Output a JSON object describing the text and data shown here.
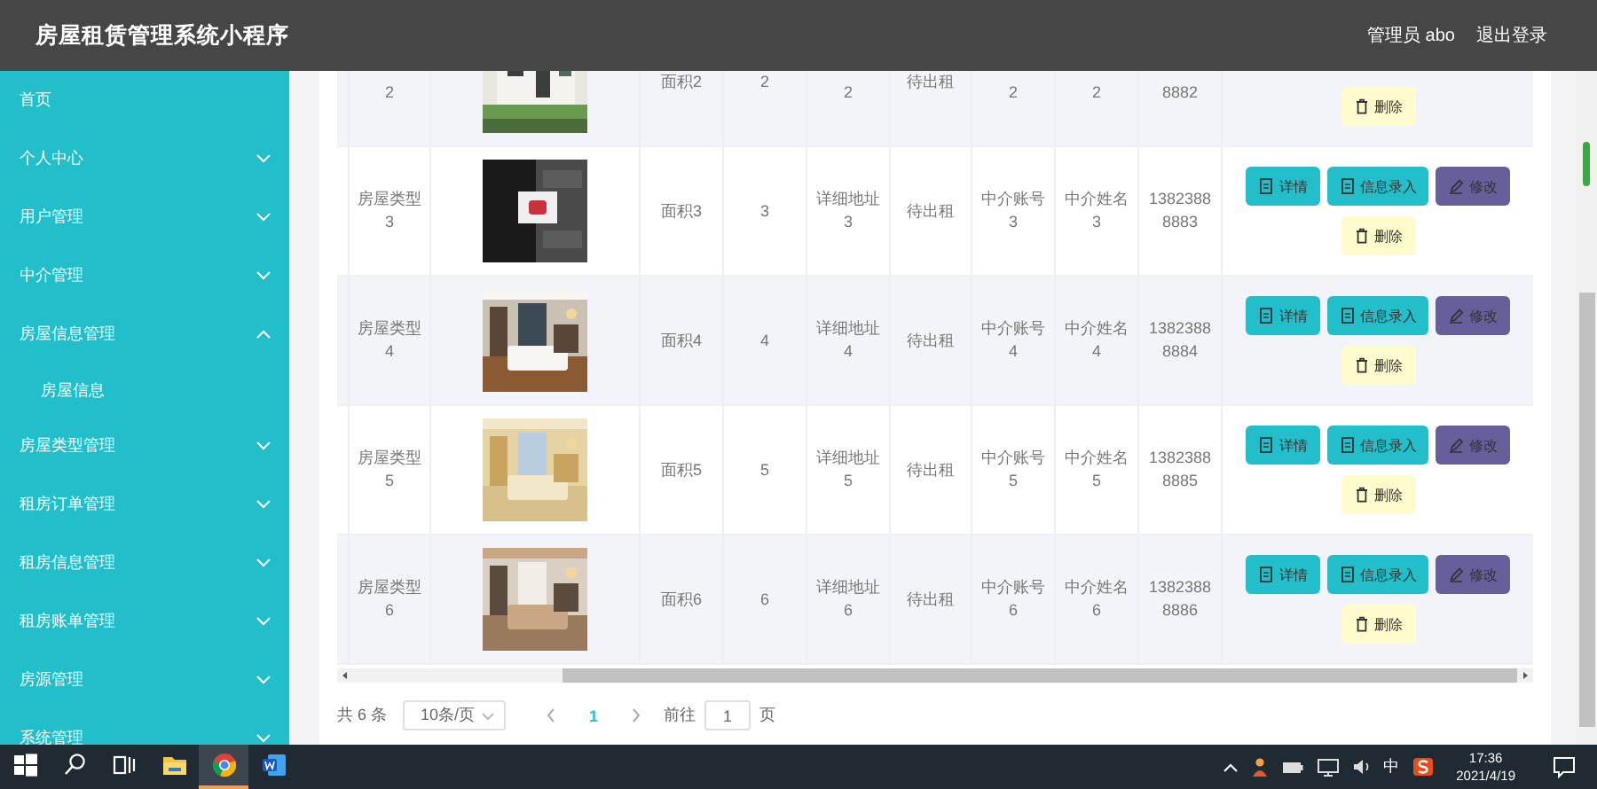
{
  "header": {
    "title": "房屋租赁管理系统小程序",
    "user": "管理员 abo",
    "logout": "退出登录"
  },
  "sidebar": {
    "items": [
      {
        "label": "首页",
        "kind": "link"
      },
      {
        "label": "个人中心",
        "kind": "menu",
        "expanded": false
      },
      {
        "label": "用户管理",
        "kind": "menu",
        "expanded": false
      },
      {
        "label": "中介管理",
        "kind": "menu",
        "expanded": false
      },
      {
        "label": "房屋信息管理",
        "kind": "menu",
        "expanded": true,
        "children": [
          {
            "label": "房屋信息"
          }
        ]
      },
      {
        "label": "房屋类型管理",
        "kind": "menu",
        "expanded": false
      },
      {
        "label": "租房订单管理",
        "kind": "menu",
        "expanded": false
      },
      {
        "label": "租房信息管理",
        "kind": "menu",
        "expanded": false
      },
      {
        "label": "租房账单管理",
        "kind": "menu",
        "expanded": false
      },
      {
        "label": "房源管理",
        "kind": "menu",
        "expanded": false
      },
      {
        "label": "系统管理",
        "kind": "menu",
        "expanded": false
      }
    ]
  },
  "table": {
    "rows": [
      {
        "cells": [
          {
            "kind": "text",
            "text": "2"
          },
          {
            "kind": "picture"
          },
          {
            "kind": "text",
            "text": "面积2"
          },
          {
            "kind": "text",
            "text": "2"
          },
          {
            "kind": "text",
            "text": "2"
          },
          {
            "kind": "text",
            "text": "待出租"
          },
          {
            "kind": "text",
            "text": "2"
          },
          {
            "kind": "text",
            "text": "2"
          },
          {
            "kind": "phone",
            "text": "8882"
          }
        ],
        "actions": [
          {
            "label": "删除",
            "kind": "delete"
          }
        ]
      },
      {
        "cells": [
          {
            "kind": "text",
            "text": "房屋类型 3"
          },
          {
            "kind": "picture"
          },
          {
            "kind": "text",
            "text": "面积3"
          },
          {
            "kind": "text",
            "text": "3"
          },
          {
            "kind": "text",
            "text": "详细地址 3"
          },
          {
            "kind": "text",
            "text": "待出租"
          },
          {
            "kind": "text",
            "text": "中介账号 3"
          },
          {
            "kind": "text",
            "text": "中介姓名 3"
          },
          {
            "kind": "phone",
            "text": "13823888883"
          }
        ],
        "actions": [
          {
            "label": "详情",
            "kind": "detail"
          },
          {
            "label": "信息录入",
            "kind": "entry"
          },
          {
            "label": "修改",
            "kind": "edit"
          },
          {
            "label": "删除",
            "kind": "delete"
          }
        ]
      },
      {
        "cells": [
          {
            "kind": "text",
            "text": "房屋类型 4"
          },
          {
            "kind": "picture"
          },
          {
            "kind": "text",
            "text": "面积4"
          },
          {
            "kind": "text",
            "text": "4"
          },
          {
            "kind": "text",
            "text": "详细地址 4"
          },
          {
            "kind": "text",
            "text": "待出租"
          },
          {
            "kind": "text",
            "text": "中介账号 4"
          },
          {
            "kind": "text",
            "text": "中介姓名 4"
          },
          {
            "kind": "phone",
            "text": "13823888884"
          }
        ],
        "actions": [
          {
            "label": "详情",
            "kind": "detail"
          },
          {
            "label": "信息录入",
            "kind": "entry"
          },
          {
            "label": "修改",
            "kind": "edit"
          },
          {
            "label": "删除",
            "kind": "delete"
          }
        ]
      },
      {
        "cells": [
          {
            "kind": "text",
            "text": "房屋类型 5"
          },
          {
            "kind": "picture"
          },
          {
            "kind": "text",
            "text": "面积5"
          },
          {
            "kind": "text",
            "text": "5"
          },
          {
            "kind": "text",
            "text": "详细地址 5"
          },
          {
            "kind": "text",
            "text": "待出租"
          },
          {
            "kind": "text",
            "text": "中介账号 5"
          },
          {
            "kind": "text",
            "text": "中介姓名 5"
          },
          {
            "kind": "phone",
            "text": "13823888885"
          }
        ],
        "actions": [
          {
            "label": "详情",
            "kind": "detail"
          },
          {
            "label": "信息录入",
            "kind": "entry"
          },
          {
            "label": "修改",
            "kind": "edit"
          },
          {
            "label": "删除",
            "kind": "delete"
          }
        ]
      },
      {
        "cells": [
          {
            "kind": "text",
            "text": "房屋类型 6"
          },
          {
            "kind": "picture"
          },
          {
            "kind": "text",
            "text": "面积6"
          },
          {
            "kind": "text",
            "text": "6"
          },
          {
            "kind": "text",
            "text": "详细地址 6"
          },
          {
            "kind": "text",
            "text": "待出租"
          },
          {
            "kind": "text",
            "text": "中介账号 6"
          },
          {
            "kind": "text",
            "text": "中介姓名 6"
          },
          {
            "kind": "phone",
            "text": "13823888886"
          }
        ],
        "actions": [
          {
            "label": "详情",
            "kind": "detail"
          },
          {
            "label": "信息录入",
            "kind": "entry"
          },
          {
            "label": "修改",
            "kind": "edit"
          },
          {
            "label": "删除",
            "kind": "delete"
          }
        ]
      }
    ]
  },
  "pagination": {
    "total": "共 6 条",
    "page_size": "10条/页",
    "pages": [
      {
        "label": "1",
        "selected": true
      }
    ],
    "goto_label": "前往",
    "goto_value": "1",
    "goto_suffix": "页"
  },
  "taskbar": {
    "buttons": [
      {
        "kind": "start",
        "selected": false
      },
      {
        "kind": "search",
        "selected": false
      },
      {
        "kind": "taskview",
        "selected": false
      },
      {
        "kind": "folder",
        "selected": false
      },
      {
        "kind": "browser",
        "selected": true
      },
      {
        "kind": "word",
        "selected": false
      }
    ],
    "tray": [
      {
        "kind": "chevron"
      },
      {
        "kind": "person"
      },
      {
        "kind": "battery"
      },
      {
        "kind": "network"
      },
      {
        "kind": "volume"
      },
      {
        "kind": "ime",
        "text": "中"
      },
      {
        "kind": "sogou"
      }
    ],
    "time": "17:36",
    "date": "2021/4/19"
  }
}
